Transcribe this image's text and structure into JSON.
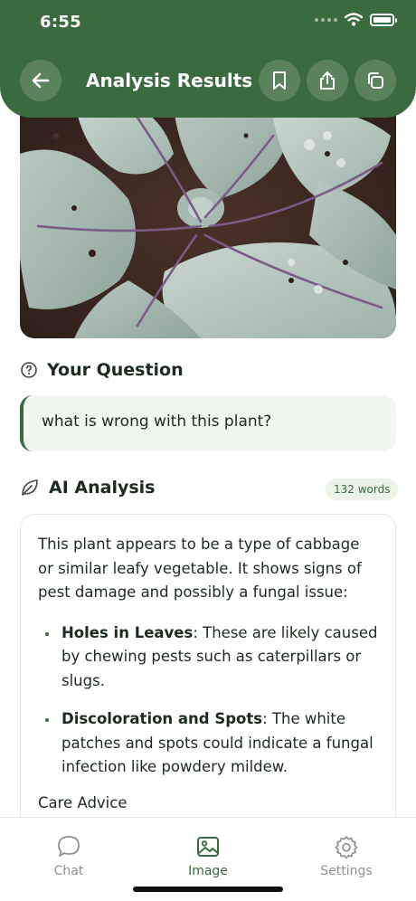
{
  "status": {
    "time": "6:55"
  },
  "header": {
    "title": "Analysis Results"
  },
  "question": {
    "heading": "Your Question",
    "text": "what is wrong with this plant?"
  },
  "analysis": {
    "heading": "AI Analysis",
    "word_count": "132 words",
    "intro": "This plant appears to be a type of cabbage or similar leafy vegetable. It shows signs of pest damage and possibly a fungal issue:",
    "items": [
      {
        "title": "Holes in Leaves",
        "text": ": These are likely caused by chewing pests such as caterpillars or slugs."
      },
      {
        "title": "Discoloration and Spots",
        "text": ": The white patches and spots could indicate a fungal infection like powdery mildew."
      }
    ],
    "cut_off": "Care Advice"
  },
  "tabs": [
    {
      "label": "Chat",
      "icon": "chat-bubble-icon"
    },
    {
      "label": "Image",
      "icon": "image-icon"
    },
    {
      "label": "Settings",
      "icon": "gear-icon"
    }
  ],
  "colors": {
    "brand": "#3a6b3f",
    "accent_bg": "#f2f6f1"
  }
}
